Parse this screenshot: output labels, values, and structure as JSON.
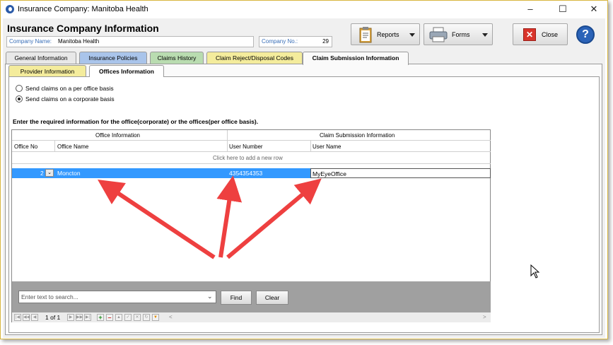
{
  "window": {
    "title": "Insurance Company:  Manitoba Health"
  },
  "header": {
    "title": "Insurance Company Information",
    "company_name_label": "Company Name:",
    "company_name_value": "Manitoba Health",
    "company_no_label": "Company No.:",
    "company_no_value": "29"
  },
  "toolbar": {
    "reports_label": "Reports",
    "forms_label": "Forms",
    "close_label": "Close",
    "help_label": "?"
  },
  "main_tabs": [
    {
      "label": "General Information",
      "color": "#e8e8e8"
    },
    {
      "label": "Insurance Policies",
      "color": "#a9c4ea"
    },
    {
      "label": "Claims History",
      "color": "#b9dcb0"
    },
    {
      "label": "Claim Reject/Disposal Codes",
      "color": "#f4ec9c"
    },
    {
      "label": "Claim Submission Information",
      "color": "#fafafa"
    }
  ],
  "sub_tabs": [
    {
      "label": "Provider Information",
      "color": "#f4ec9c"
    },
    {
      "label": "Offices Information",
      "color": "#ffffff"
    }
  ],
  "options": {
    "per_office": "Send claims on a per office basis",
    "corporate": "Send claims on a corporate basis",
    "selected": "corporate"
  },
  "instruction": "Enter the required information for the office(corporate) or the offices(per office basis).",
  "grid": {
    "group_headers": [
      "Office Information",
      "Claim Submission Information"
    ],
    "columns": [
      "Office No",
      "Office Name",
      "User Number",
      "User Name"
    ],
    "add_row_text": "Click here to add a new row",
    "rows": [
      {
        "office_no": "2",
        "office_name": "Moncton",
        "user_number": "4354354353",
        "user_name": "MyEyeOffice"
      }
    ]
  },
  "search": {
    "placeholder": "Enter text to search...",
    "find_label": "Find",
    "clear_label": "Clear"
  },
  "pager": {
    "page_text": "1 of 1"
  },
  "colors": {
    "selection": "#3399ff",
    "annotation_arrow": "#ee4040",
    "window_border": "#d8b640"
  }
}
